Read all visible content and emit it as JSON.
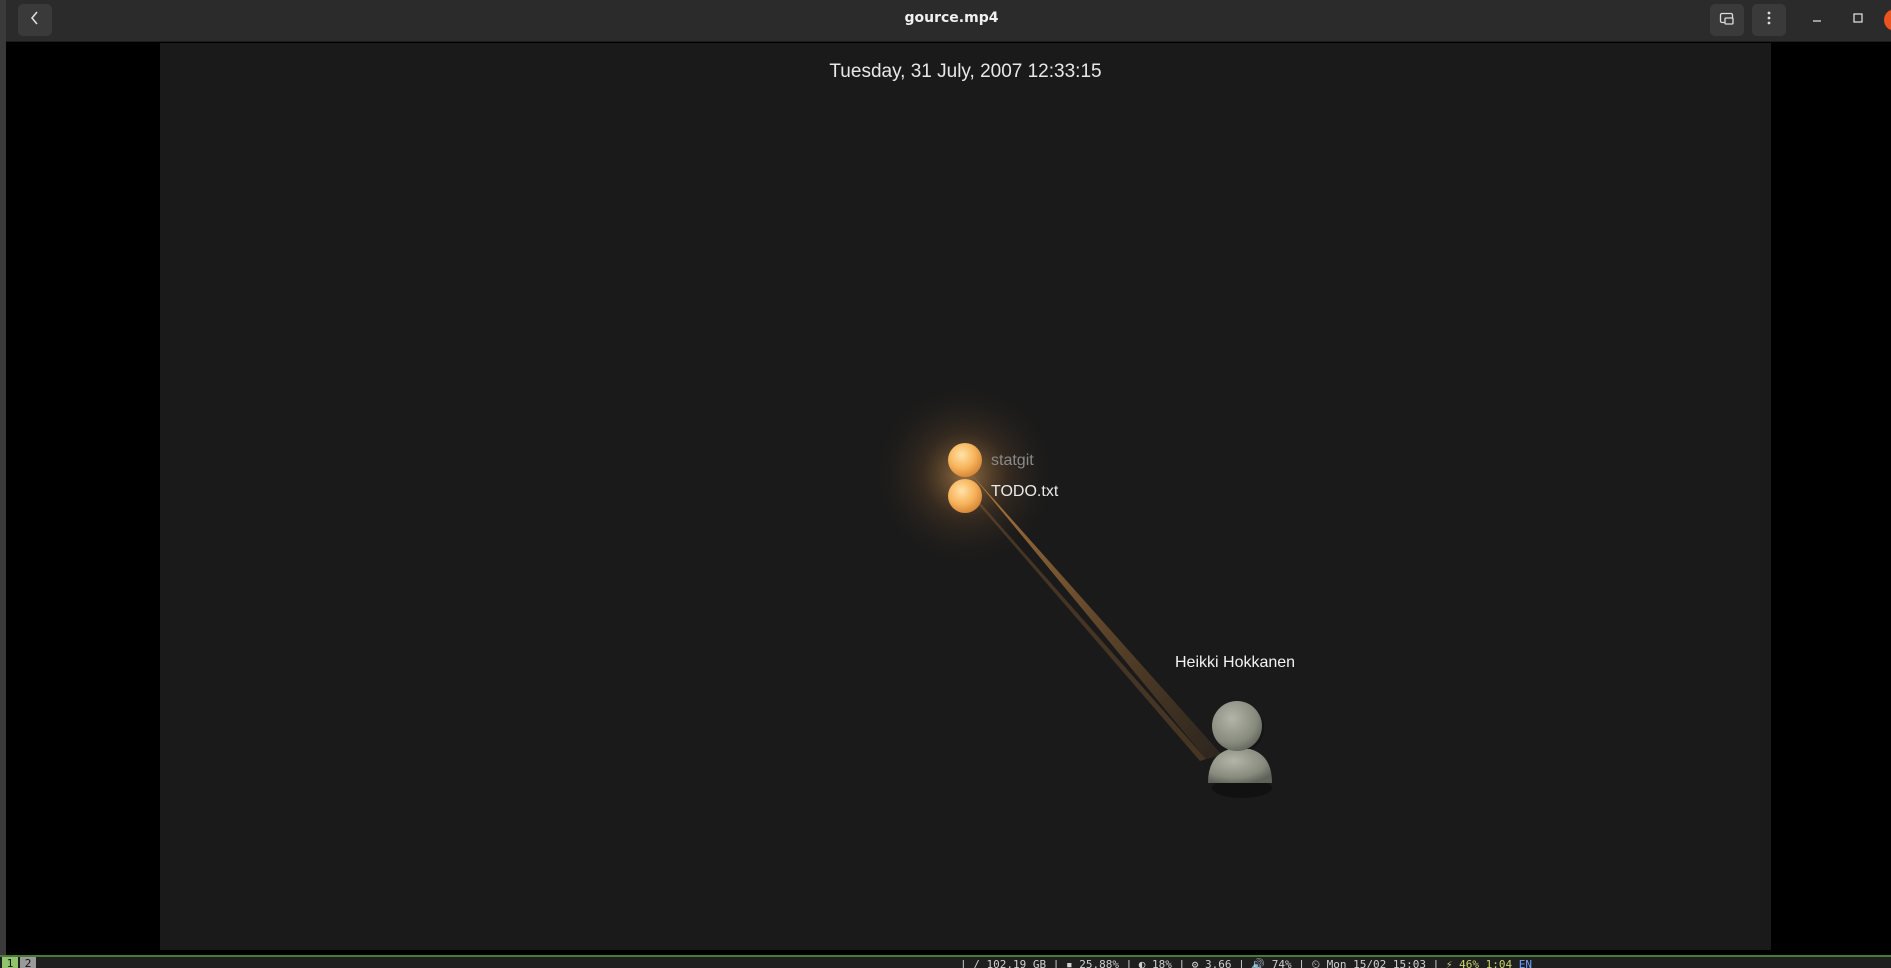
{
  "window": {
    "title": "gource.mp4"
  },
  "titlebar": {
    "back_icon": "chevron-left-icon",
    "restore_icon": "picture-in-picture-icon",
    "menu_icon": "kebab-menu-icon",
    "min_icon": "minimize-icon",
    "max_icon": "maximize-icon",
    "close_icon": "close-icon"
  },
  "video": {
    "datetime": "Tuesday, 31 July, 2007 12:33:15",
    "files": [
      {
        "name": "statgit"
      },
      {
        "name": "TODO.txt"
      }
    ],
    "user": "Heikki Hokkanen"
  },
  "statusbar": {
    "workspaces": [
      "1",
      "2"
    ],
    "text": "| / 102.19 GB | ▪ 25.88% | ◐ 18% | ⚙ 3.66 | 🔊 74% | ⏲ Mon 15/02 15:03 |",
    "battery": "⚡ 46% 1:04",
    "lang": "EN"
  },
  "colors": {
    "accent": "#e95420",
    "workspace_active": "#8fc46c",
    "file_node": "#f5b45a",
    "user_avatar": "#8c8f82"
  }
}
